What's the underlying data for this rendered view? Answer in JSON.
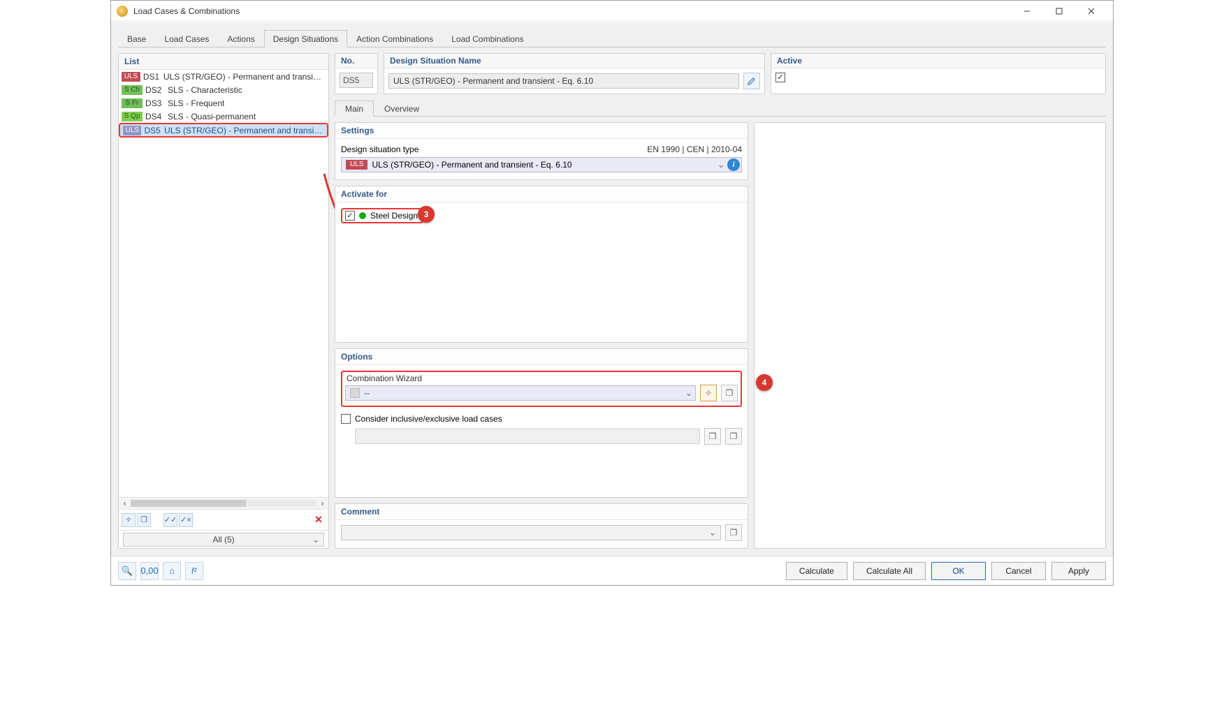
{
  "window": {
    "title": "Load Cases & Combinations"
  },
  "tabs": [
    "Base",
    "Load Cases",
    "Actions",
    "Design Situations",
    "Action Combinations",
    "Load Combinations"
  ],
  "active_tab_index": 3,
  "left": {
    "header": "List",
    "items": [
      {
        "tag": "ULS",
        "tagClass": "uls-tag",
        "code": "DS1",
        "text": "ULS (STR/GEO) - Permanent and transient - Eq."
      },
      {
        "tag": "S Ch",
        "tagClass": "sc-tag",
        "code": "DS2",
        "text": "SLS - Characteristic"
      },
      {
        "tag": "S Fr",
        "tagClass": "sf-tag",
        "code": "DS3",
        "text": "SLS - Frequent"
      },
      {
        "tag": "S Qp",
        "tagClass": "sq-tag",
        "code": "DS4",
        "text": "SLS - Quasi-permanent"
      },
      {
        "tag": "ULS",
        "tagClass": "uls-tag sel",
        "code": "DS5",
        "text": "ULS (STR/GEO) - Permanent and transient - Eq."
      }
    ],
    "selected_index": 4,
    "filter": "All (5)"
  },
  "fields": {
    "no_label": "No.",
    "no_value": "DS5",
    "name_label": "Design Situation Name",
    "name_value": "ULS (STR/GEO) - Permanent and transient - Eq. 6.10",
    "active_label": "Active"
  },
  "subtabs": [
    "Main",
    "Overview"
  ],
  "active_subtab_index": 0,
  "settings": {
    "header": "Settings",
    "type_label": "Design situation type",
    "type_right": "EN 1990 | CEN | 2010-04",
    "type_value": "ULS (STR/GEO) - Permanent and transient - Eq. 6.10"
  },
  "activate": {
    "header": "Activate for",
    "steel_label": "Steel Design"
  },
  "options": {
    "header": "Options",
    "combo_label": "Combination Wizard",
    "combo_value": "--",
    "consider_label": "Consider inclusive/exclusive load cases"
  },
  "comment": {
    "header": "Comment"
  },
  "callouts": {
    "c3": "3",
    "c4": "4"
  },
  "buttons": {
    "calculate": "Calculate",
    "calculate_all": "Calculate All",
    "ok": "OK",
    "cancel": "Cancel",
    "apply": "Apply"
  }
}
